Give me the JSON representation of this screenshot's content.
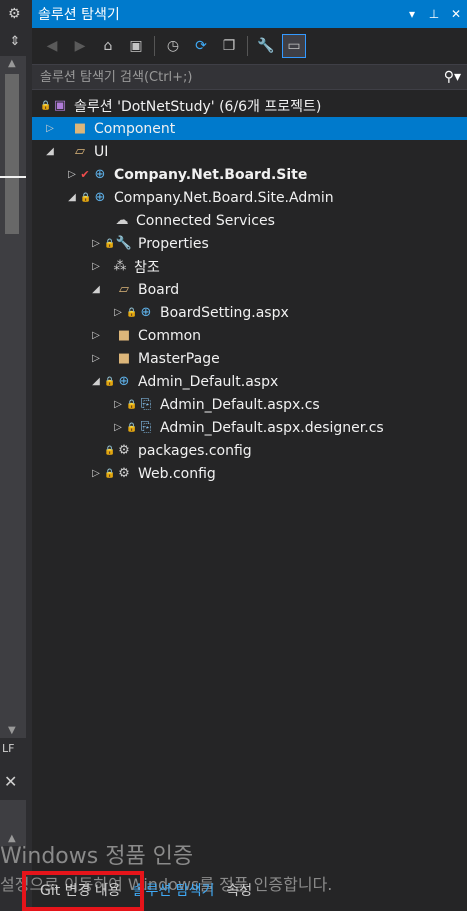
{
  "window": {
    "title": "솔루션 탐색기"
  },
  "titlebar_buttons": [
    "dropdown-icon",
    "pin-icon",
    "close-icon"
  ],
  "left_strip": {
    "lf_label": "LF"
  },
  "search": {
    "placeholder": "솔루션 탐색기 검색(Ctrl+;)"
  },
  "tree": {
    "solution": "솔루션 'DotNetStudy' (6/6개 프로젝트)",
    "items": [
      {
        "label": "Component"
      },
      {
        "label": "UI"
      },
      {
        "label": "Company.Net.Board.Site"
      },
      {
        "label": "Company.Net.Board.Site.Admin"
      },
      {
        "label": "Connected Services"
      },
      {
        "label": "Properties"
      },
      {
        "label": "참조"
      },
      {
        "label": "Board"
      },
      {
        "label": "BoardSetting.aspx"
      },
      {
        "label": "Common"
      },
      {
        "label": "MasterPage"
      },
      {
        "label": "Admin_Default.aspx"
      },
      {
        "label": "Admin_Default.aspx.cs"
      },
      {
        "label": "Admin_Default.aspx.designer.cs"
      },
      {
        "label": "packages.config"
      },
      {
        "label": "Web.config"
      }
    ]
  },
  "watermark": {
    "line1": "Windows 정품 인증",
    "line2": "설정으로 이동하여 Windows를 정품 인증합니다."
  },
  "bottom_tabs": [
    {
      "label": "Git 변경 내용"
    },
    {
      "label": "솔루션 탐색기"
    },
    {
      "label": "속성"
    }
  ],
  "colors": {
    "accent": "#007acc",
    "background": "#252526",
    "highlight_box": "#e5141a"
  }
}
